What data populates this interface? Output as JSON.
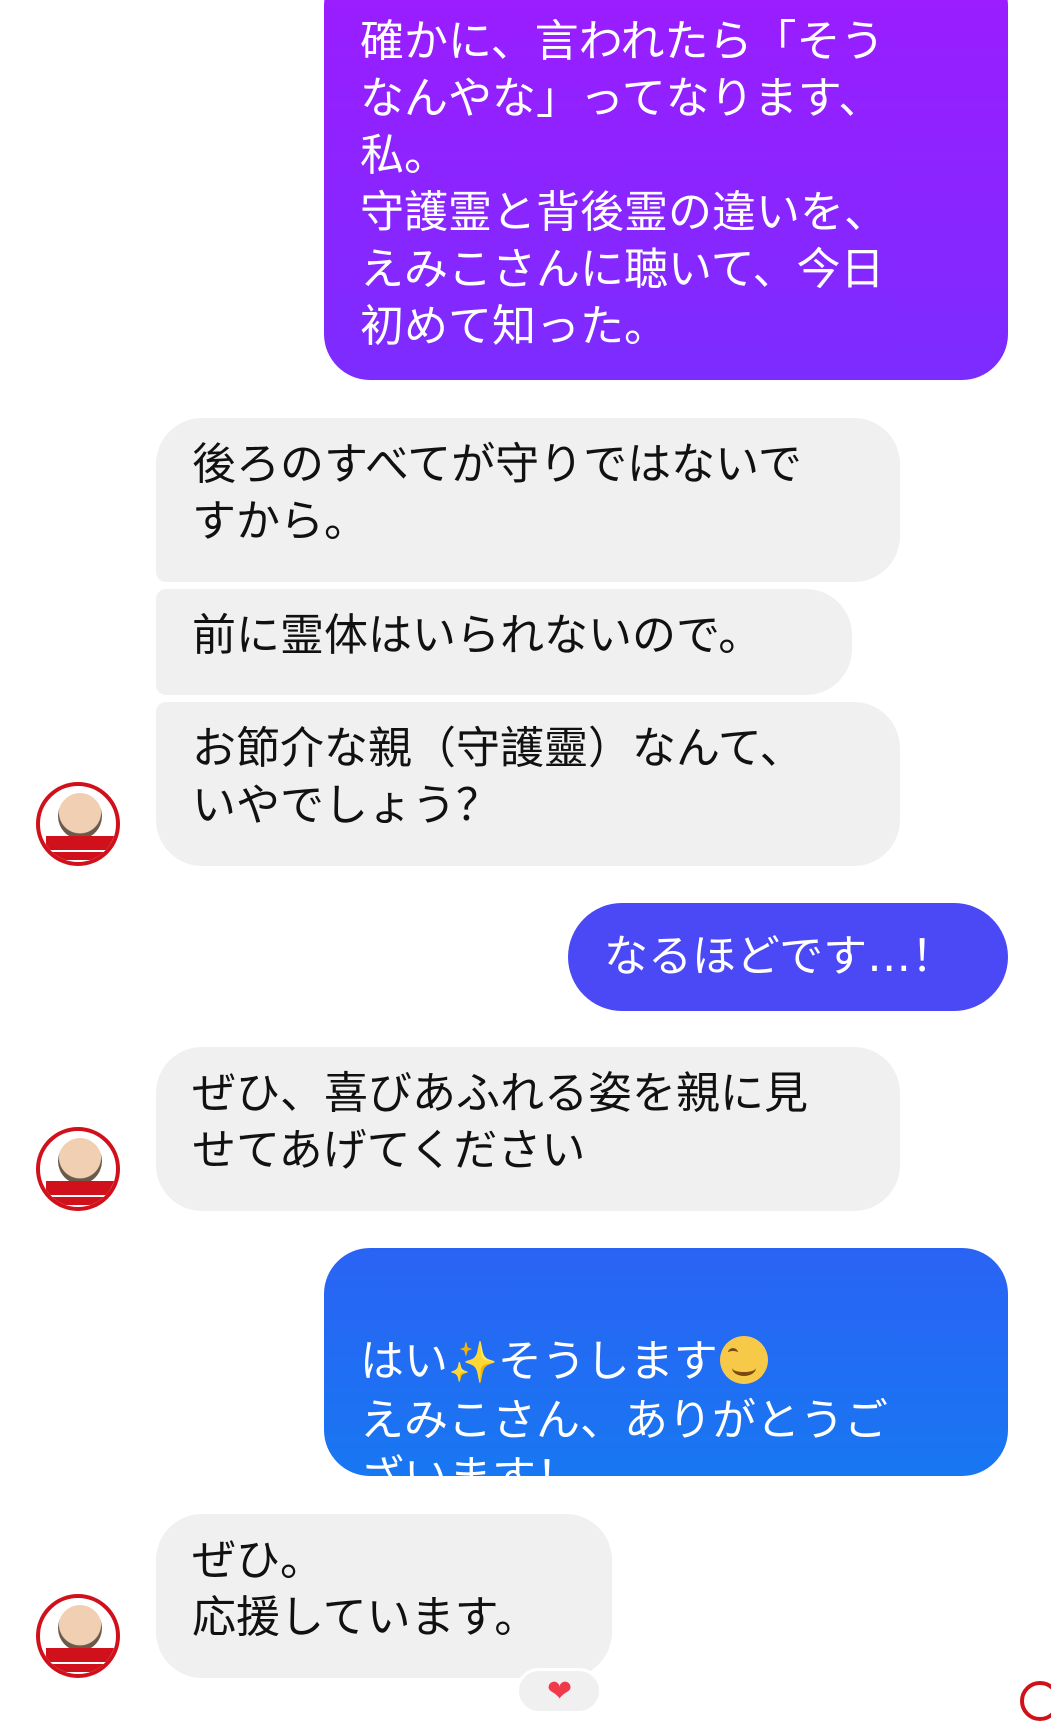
{
  "conversation": {
    "messages": [
      {
        "sender": "me",
        "text": "確かに、言われたら「そう\nなんやな」ってなります、\n私。\n守護霊と背後霊の違いを、\nえみこさんに聴いて、今日\n初めて知った。"
      },
      {
        "sender": "them",
        "text": "後ろのすべてが守りではないで\nすから。"
      },
      {
        "sender": "them",
        "text": "前に霊体はいられないので。"
      },
      {
        "sender": "them",
        "text": "お節介な親（守護靈）なんて、\nいやでしょう？"
      },
      {
        "sender": "me",
        "text": "なるほどです…！"
      },
      {
        "sender": "them",
        "text": "ぜひ、喜びあふれる姿を親に見\nせてあげてください"
      },
      {
        "sender": "me",
        "text_parts": [
          "はい",
          "そうします",
          "\nえみこさん、ありがとうご\nざいます！"
        ],
        "emoji": [
          "sparkles-emoji",
          "smiling-face-emoji"
        ]
      },
      {
        "sender": "them",
        "text": "ぜひ。\n応援しています。"
      }
    ],
    "reaction": {
      "emoji": "❤"
    },
    "colors": {
      "outgoing_purple_top": "#9d1cff",
      "outgoing_purple_bottom": "#7c2cff",
      "outgoing_indigo": "#4b48f6",
      "outgoing_blue_top": "#2a63f4",
      "outgoing_blue_bottom": "#1877f2",
      "incoming_bg": "#f0f0f0",
      "avatar_ring": "#d0111b"
    }
  }
}
